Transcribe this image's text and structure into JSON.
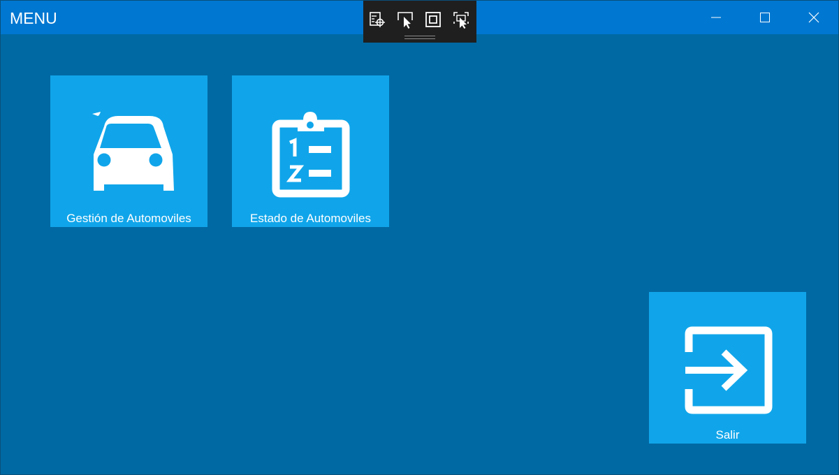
{
  "window": {
    "title": "MENU"
  },
  "title_bar_buttons": [
    "minimize-icon",
    "maximize-icon",
    "close-icon"
  ],
  "debug_toolbar": {
    "icons": [
      "select-element-icon",
      "pointer-select-icon",
      "display-layout-icon",
      "track-focus-icon"
    ]
  },
  "tiles": [
    {
      "label": "Gestión de Automoviles",
      "icon": "car-icon"
    },
    {
      "label": "Estado de Automoviles",
      "icon": "clipboard-list-icon"
    },
    {
      "label": "Salir",
      "icon": "sign-in-arrow-icon"
    }
  ],
  "colors": {
    "background": "#0069a3",
    "title_bar": "#0077d1",
    "tile": "#10a5ea",
    "debug_toolbar": "#1f1f1f"
  }
}
